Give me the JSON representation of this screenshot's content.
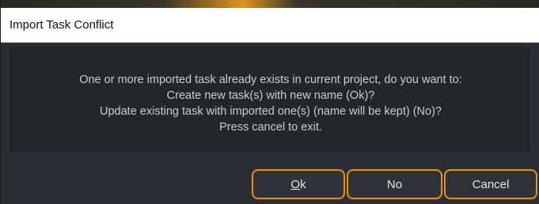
{
  "dialog": {
    "title": "Import Task Conflict",
    "message_lines": [
      "One or more imported task already exists in current project, do you want to:",
      "Create new task(s) with new name (Ok)?",
      "Update existing task with imported one(s) (name will be kept) (No)?",
      "Press cancel to exit."
    ],
    "buttons": {
      "ok_label": "Ok",
      "no_label": "No",
      "cancel_label": "Cancel"
    }
  },
  "colors": {
    "accent": "#e8940f",
    "background": "#2b2f35",
    "panel": "#23262b",
    "text": "#c9ced6"
  }
}
